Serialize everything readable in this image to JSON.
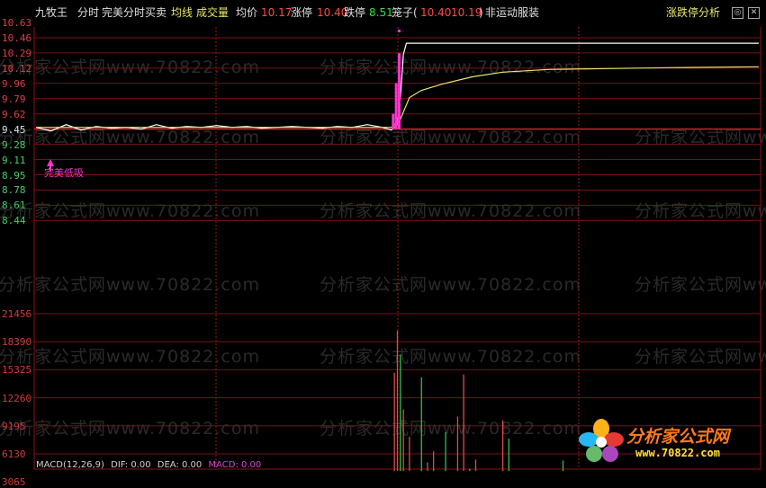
{
  "header": {
    "app_name": "九牧王",
    "mode": "分时",
    "indicator": "完美分时买卖",
    "avg_line_label": "均线",
    "volume_label": "成交量",
    "avg_price_label": "均价",
    "avg_price_value": "10.17",
    "limit_up_label": "涨停",
    "limit_up_value": "10.40",
    "limit_down_label": "跌停",
    "limit_down_value": "8.51",
    "cage_label": "笼子(",
    "cage_high": "10.40",
    "cage_low": "10.19",
    "cage_close": ")",
    "sector": "非运动服装",
    "right_button": "涨跌停分析",
    "window_controls": [
      "◎",
      "✕"
    ]
  },
  "price_axis": [
    "10.63",
    "10.46",
    "10.29",
    "10.12",
    "9.96",
    "9.79",
    "9.62",
    "9.45",
    "9.28",
    "9.11",
    "8.95",
    "8.78",
    "8.61",
    "8.44"
  ],
  "volume_axis": [
    "21456",
    "18390",
    "15325",
    "12260",
    "9195",
    "6130",
    "3065"
  ],
  "signal_label": "完美低吸",
  "watermark_text": "分析家公式网www.70822.com",
  "logo": {
    "name": "分析家公式网",
    "url": "www.70822.com"
  },
  "macd_bar": {
    "label": "MACD(12,26,9)",
    "dif": "DIF: 0.00",
    "dea": "DEA: 0.00",
    "macd": "MACD: 0.00"
  },
  "colors": {
    "price_line": "#ffffff",
    "avg_line": "#e8e870",
    "grid": "#7a1010",
    "baseline": "#c02828",
    "signal": "#ff33cc",
    "volume_up": "#e24a4a",
    "volume_down": "#2fbf4f"
  },
  "chart_data": {
    "type": "line",
    "title": "九牧王 分时",
    "ylim": [
      8.44,
      10.63
    ],
    "baseline_price": 9.45,
    "limit_up": 10.4,
    "series": [
      {
        "name": "price",
        "x_minutes": [
          0,
          5,
          10,
          15,
          20,
          25,
          30,
          35,
          40,
          45,
          50,
          55,
          60,
          65,
          70,
          75,
          80,
          85,
          90,
          95,
          100,
          105,
          110,
          115,
          118,
          120,
          121,
          122,
          123,
          124,
          125,
          240
        ],
        "values": [
          9.47,
          9.43,
          9.5,
          9.44,
          9.48,
          9.46,
          9.47,
          9.45,
          9.5,
          9.46,
          9.48,
          9.47,
          9.49,
          9.47,
          9.48,
          9.46,
          9.47,
          9.48,
          9.47,
          9.46,
          9.48,
          9.47,
          9.5,
          9.47,
          9.44,
          9.5,
          9.8,
          10.28,
          10.4,
          10.4,
          10.4,
          10.4
        ]
      },
      {
        "name": "avg",
        "x_minutes": [
          0,
          30,
          60,
          90,
          118,
          121,
          124,
          128,
          135,
          145,
          155,
          170,
          190,
          210,
          240
        ],
        "values": [
          9.47,
          9.47,
          9.47,
          9.47,
          9.47,
          9.56,
          9.8,
          9.88,
          9.95,
          10.03,
          10.08,
          10.11,
          10.12,
          10.13,
          10.14
        ]
      }
    ],
    "volume_ylim": [
      0,
      21456
    ],
    "volume": [
      [
        2,
        1400
      ],
      [
        5,
        900
      ],
      [
        8,
        1700
      ],
      [
        12,
        600
      ],
      [
        15,
        1100
      ],
      [
        18,
        2000
      ],
      [
        22,
        700
      ],
      [
        26,
        1300
      ],
      [
        30,
        500
      ],
      [
        34,
        1800
      ],
      [
        38,
        900
      ],
      [
        42,
        2200
      ],
      [
        46,
        600
      ],
      [
        50,
        1400
      ],
      [
        54,
        800
      ],
      [
        58,
        2600
      ],
      [
        62,
        700
      ],
      [
        66,
        1200
      ],
      [
        70,
        900
      ],
      [
        74,
        1600
      ],
      [
        78,
        500
      ],
      [
        82,
        1100
      ],
      [
        86,
        800
      ],
      [
        90,
        1300
      ],
      [
        94,
        600
      ],
      [
        98,
        900
      ],
      [
        102,
        1500
      ],
      [
        106,
        700
      ],
      [
        110,
        1000
      ],
      [
        114,
        1800
      ],
      [
        118,
        2500
      ],
      [
        119,
        15000
      ],
      [
        120,
        19600
      ],
      [
        121,
        17000
      ],
      [
        122,
        11000
      ],
      [
        124,
        8000
      ],
      [
        126,
        4000
      ],
      [
        128,
        14500
      ],
      [
        130,
        5200
      ],
      [
        132,
        6400
      ],
      [
        134,
        3500
      ],
      [
        136,
        8500
      ],
      [
        138,
        3800
      ],
      [
        140,
        10200
      ],
      [
        142,
        14800
      ],
      [
        144,
        4500
      ],
      [
        146,
        5500
      ],
      [
        150,
        4200
      ],
      [
        155,
        9800
      ],
      [
        157,
        7800
      ],
      [
        160,
        3200
      ],
      [
        165,
        2600
      ],
      [
        170,
        1800
      ],
      [
        175,
        5400
      ],
      [
        180,
        1100
      ],
      [
        185,
        2400
      ],
      [
        190,
        900
      ],
      [
        195,
        1600
      ],
      [
        200,
        700
      ],
      [
        205,
        1300
      ],
      [
        210,
        600
      ],
      [
        215,
        1100
      ],
      [
        220,
        900
      ],
      [
        225,
        1500
      ],
      [
        230,
        700
      ],
      [
        235,
        1900
      ],
      [
        239,
        2400
      ]
    ]
  }
}
